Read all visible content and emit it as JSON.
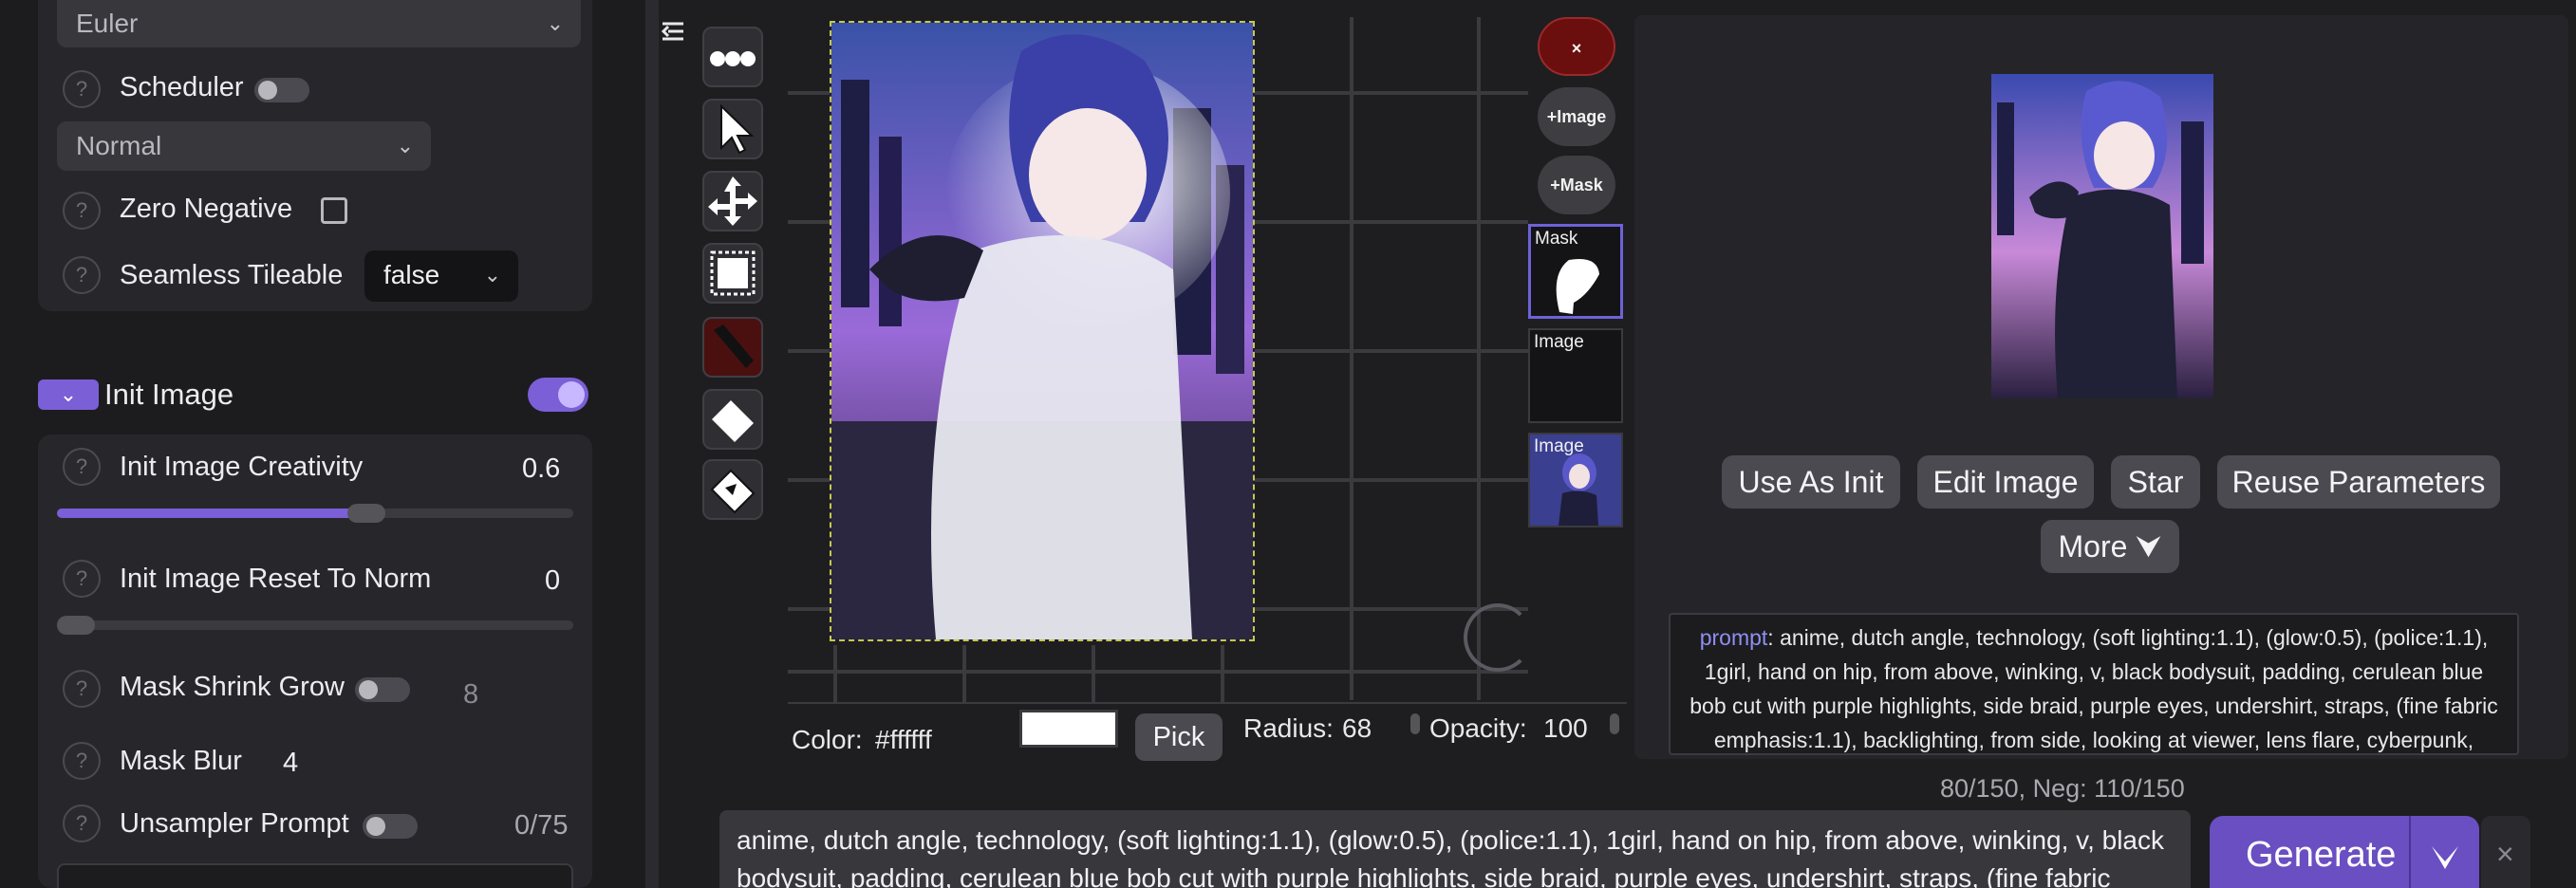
{
  "left_panel": {
    "sampler_value": "Euler",
    "scheduler_label": "Scheduler",
    "scheduler_value": "Normal",
    "zero_negative_label": "Zero Negative",
    "seamless_label": "Seamless Tileable",
    "seamless_value": "false",
    "init_image_title": "Init Image",
    "init_image_toggle_icon": "chevron-down-icon",
    "creativity_label": "Init Image Creativity",
    "creativity_value": "0.6",
    "creativity_fraction": 0.6,
    "reset_norm_label": "Init Image Reset To Norm",
    "reset_norm_value": "0",
    "mask_shrink_label": "Mask Shrink Grow",
    "mask_shrink_value": "8",
    "mask_blur_label": "Mask Blur",
    "mask_blur_value": "4",
    "unsampler_label": "Unsampler Prompt",
    "unsampler_count": "0/75",
    "help_glyph": "?"
  },
  "canvas": {
    "collapse_icon": "menu-collapse-icon",
    "tools": [
      "more-options-icon",
      "pointer-icon",
      "move-icon",
      "select-icon",
      "brush-icon",
      "eraser-icon",
      "paint-bucket-icon"
    ],
    "remove_label": "×",
    "add_image_label": "+Image",
    "add_mask_label": "+Mask",
    "layers": [
      "Mask",
      "Image",
      "Image"
    ],
    "color_label": "Color:",
    "color_value": "#ffffff",
    "pick_label": "Pick",
    "radius_label": "Radius:",
    "radius_value": "68",
    "opacity_label": "Opacity:",
    "opacity_value": "100"
  },
  "result": {
    "buttons": [
      "Use As Init",
      "Edit Image",
      "Star",
      "Reuse Parameters"
    ],
    "more_label": "More ⮟",
    "meta_key": "prompt",
    "meta_text": "anime, dutch angle, technology, (soft lighting:1.1), (glow:0.5), (police:1.1), 1girl, hand on hip, from above, winking, v, black bodysuit, padding, cerulean blue bob cut with purple highlights, side braid, purple eyes, undershirt, straps, (fine fabric emphasis:1.1), backlighting, from side, looking at viewer, lens flare, cyberpunk, night,"
  },
  "prompt": {
    "counter": "80/150, Neg: 110/150",
    "text": "anime, dutch angle, technology, (soft lighting:1.1), (glow:0.5), (police:1.1), 1girl, hand on hip, from above, winking, v, black bodysuit, padding, cerulean blue bob cut with purple highlights, side braid, purple eyes, undershirt, straps, (fine fabric",
    "generate_label": "Generate",
    "generate_menu_icon": "chevron-down-icon",
    "cancel_label": "×"
  },
  "colors": {
    "accent": "#7b5fd6",
    "panel": "#27272b",
    "background": "#1e1e21"
  }
}
